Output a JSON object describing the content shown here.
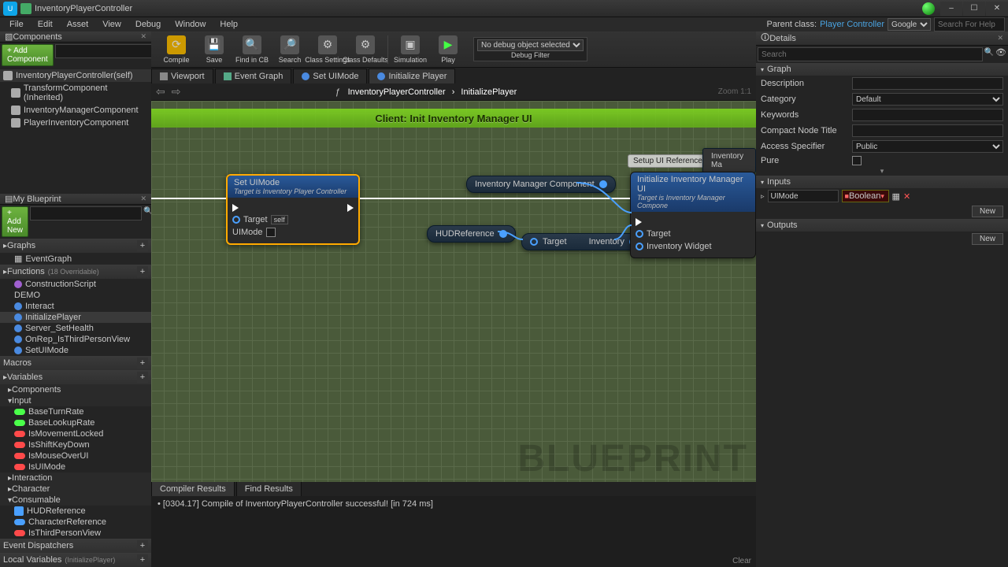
{
  "titlebar": {
    "title": "InventoryPlayerController"
  },
  "winbuttons": [
    "–",
    "☐",
    "✕"
  ],
  "menubar": [
    "File",
    "Edit",
    "Asset",
    "View",
    "Debug",
    "Window",
    "Help"
  ],
  "parent_class": {
    "label": "Parent class:",
    "value": "Player Controller"
  },
  "search_engine": "Google",
  "search_hint": "Search For Help",
  "components_panel": {
    "title": "Components",
    "add_label": "+ Add Component",
    "root": "InventoryPlayerController(self)",
    "items": [
      "TransformComponent (Inherited)",
      "InventoryManagerComponent",
      "PlayerInventoryComponent"
    ]
  },
  "myblueprint": {
    "title": "My Blueprint",
    "add_label": "+ Add New",
    "sections": {
      "graphs": {
        "title": "Graphs",
        "items": [
          "EventGraph"
        ]
      },
      "functions": {
        "title": "Functions",
        "suffix": "(18 Overridable)",
        "items": [
          "ConstructionScript",
          "DEMO",
          "Interact",
          "InitializePlayer",
          "Server_SetHealth",
          "OnRep_IsThirdPersonView",
          "SetUIMode"
        ]
      },
      "macros": {
        "title": "Macros"
      },
      "variables": {
        "title": "Variables",
        "groups": [
          {
            "name": "Components"
          },
          {
            "name": "Input",
            "items": [
              {
                "n": "BaseTurnRate",
                "c": "green"
              },
              {
                "n": "BaseLookupRate",
                "c": "green"
              },
              {
                "n": "IsMovementLocked",
                "c": "red"
              },
              {
                "n": "IsShiftKeyDown",
                "c": "red"
              },
              {
                "n": "IsMouseOverUI",
                "c": "red"
              },
              {
                "n": "IsUIMode",
                "c": "red"
              }
            ]
          },
          {
            "name": "Interaction"
          },
          {
            "name": "Character"
          },
          {
            "name": "Consumable",
            "items": [
              {
                "n": "HUDReference",
                "c": "bluefill"
              },
              {
                "n": "CharacterReference",
                "c": "blue"
              },
              {
                "n": "IsThirdPersonView",
                "c": "red"
              }
            ]
          }
        ]
      },
      "dispatchers": {
        "title": "Event Dispatchers"
      },
      "localvars": {
        "title": "Local Variables",
        "suffix": "(InitializePlayer)"
      }
    }
  },
  "toolbar": [
    {
      "icon": "⟳",
      "label": "Compile"
    },
    {
      "icon": "💾",
      "label": "Save"
    },
    {
      "icon": "🔍",
      "label": "Find in CB"
    },
    {
      "icon": "🔎",
      "label": "Search"
    },
    {
      "icon": "⚙",
      "label": "Class Settings"
    },
    {
      "icon": "⚙",
      "label": "Class Defaults"
    },
    {
      "icon": "▣",
      "label": "Simulation"
    },
    {
      "icon": "▶",
      "label": "Play"
    }
  ],
  "debug": {
    "selected": "No debug object selected",
    "filter": "Debug Filter"
  },
  "graph_tabs": [
    {
      "label": "Viewport"
    },
    {
      "label": "Event Graph"
    },
    {
      "label": "Set UIMode"
    },
    {
      "label": "Initialize Player",
      "active": true
    }
  ],
  "breadcrumb": {
    "a": "InventoryPlayerController",
    "b": "InitializePlayer"
  },
  "zoom": "Zoom 1:1",
  "banner": "Client: Init Inventory Manager UI",
  "watermark": "BLUEPRINT",
  "nodes": {
    "setuimode": {
      "title": "Set UIMode",
      "sub": "Target is Inventory Player Controller",
      "pins": {
        "target": "Target",
        "self": "self",
        "uimode": "UIMode"
      }
    },
    "invmgrcomp": "Inventory Manager Component",
    "hudref": "HUDReference",
    "getinv": {
      "target": "Target",
      "out": "Inventory"
    },
    "initinv": {
      "title": "Initialize Inventory Manager UI",
      "sub": "Target is Inventory Manager Compone",
      "pins": {
        "target": "Target",
        "widget": "Inventory Widget"
      }
    },
    "comment": "Setup UI References",
    "floating": "Inventory Ma"
  },
  "bottom_tabs": [
    "Compiler Results",
    "Find Results"
  ],
  "compile_msg": "[0304.17] Compile of InventoryPlayerController successful! [in 724 ms]",
  "clear": "Clear",
  "details": {
    "title": "Details",
    "search": "Search",
    "graph_section": "Graph",
    "rows": {
      "description": "Description",
      "category": "Category",
      "category_val": "Default",
      "keywords": "Keywords",
      "compact": "Compact Node Title",
      "access": "Access Specifier",
      "access_val": "Public",
      "pure": "Pure"
    },
    "inputs_section": "Inputs",
    "input_item": {
      "name": "UIMode",
      "type": "Boolean"
    },
    "outputs_section": "Outputs",
    "new": "New"
  }
}
